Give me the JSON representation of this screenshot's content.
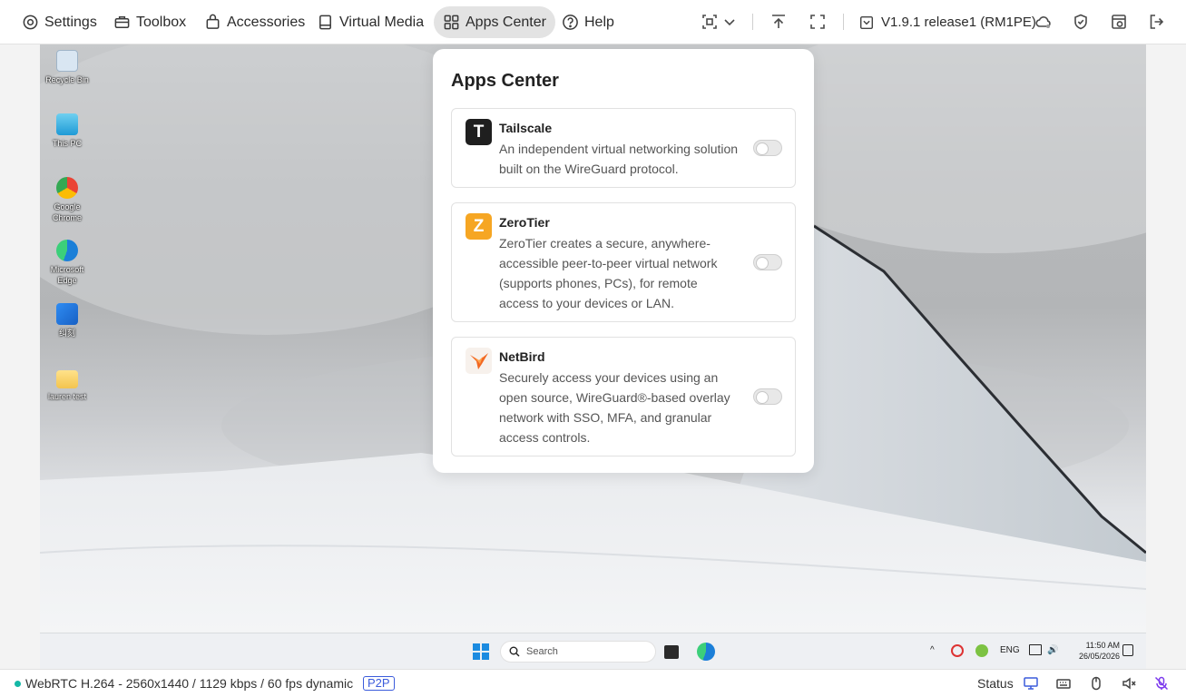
{
  "toolbar": {
    "menu": [
      {
        "label": "Settings",
        "icon": "gear-icon"
      },
      {
        "label": "Toolbox",
        "icon": "toolbox-icon"
      },
      {
        "label": "Accessories",
        "icon": "bag-icon"
      },
      {
        "label": "Virtual Media",
        "icon": "drive-icon"
      },
      {
        "label": "Apps Center",
        "icon": "apps-grid-icon",
        "active": true
      },
      {
        "label": "Help",
        "icon": "help-icon"
      }
    ],
    "version": "V1.9.1 release1 (RM1PE)"
  },
  "desktop": {
    "icons": [
      {
        "label": "Recycle Bin"
      },
      {
        "label": "This PC"
      },
      {
        "label": "Google Chrome"
      },
      {
        "label": "Microsoft Edge"
      },
      {
        "label": "纠刻"
      },
      {
        "label": "lauren test"
      }
    ],
    "taskbar": {
      "search_label": "Search",
      "language": "ENG",
      "time": "11:50 AM",
      "date": "26/05/2026"
    }
  },
  "apps_center": {
    "title": "Apps Center",
    "apps": [
      {
        "name": "Tailscale",
        "description": "An independent virtual networking solution built on the WireGuard protocol.",
        "logo_letter": "T",
        "enabled": false,
        "color": "#1f1f1f"
      },
      {
        "name": "ZeroTier",
        "description": "ZeroTier creates a secure, anywhere-accessible peer-to-peer virtual network (supports phones, PCs), for remote access to your devices or LAN.",
        "logo_letter": "Z",
        "enabled": false,
        "color": "#f6a623"
      },
      {
        "name": "NetBird",
        "description": "Securely access your devices using an open source, WireGuard®-based overlay network with SSO, MFA, and granular access controls.",
        "logo_letter": "",
        "enabled": false,
        "color": "#f26822"
      }
    ]
  },
  "statusbar": {
    "stream_info": "WebRTC H.264 - 2560x1440 / 1129 kbps / 60 fps dynamic",
    "mode_badge": "P2P",
    "status_label": "Status",
    "accent_color": "#14b8a6",
    "badge_color": "#3b5bdb"
  }
}
